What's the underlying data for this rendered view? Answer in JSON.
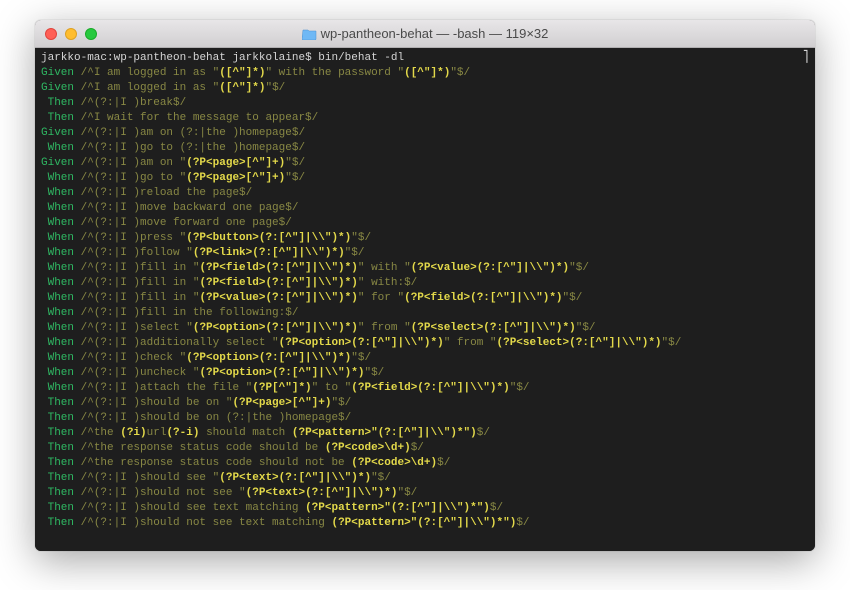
{
  "window": {
    "title": "wp-pantheon-behat — -bash — 119×32"
  },
  "prompt": {
    "host": "jarkko-mac",
    "dir": "wp-pantheon-behat",
    "user": "jarkkolaine",
    "command": "bin/behat -dl"
  },
  "lines": [
    {
      "kw": "Given",
      "pre": " /^I am logged in as \"",
      "hl": "([^\"]*)",
      "mid": "\" with the password \"",
      "hl2": "([^\"]*)",
      "post": "\"$/"
    },
    {
      "kw": "Given",
      "pre": " /^I am logged in as \"",
      "hl": "([^\"]*)",
      "post": "\"$/"
    },
    {
      "kw": " Then",
      "pre": " /^(?:|I )break$/"
    },
    {
      "kw": " Then",
      "pre": " /^I wait for the message to appear$/"
    },
    {
      "kw": "Given",
      "pre": " /^(?:|I )am on (?:|the )homepage$/"
    },
    {
      "kw": " When",
      "pre": " /^(?:|I )go to (?:|the )homepage$/"
    },
    {
      "kw": "Given",
      "pre": " /^(?:|I )am on \"",
      "hl": "(?P<page>[^\"]+)",
      "post": "\"$/"
    },
    {
      "kw": " When",
      "pre": " /^(?:|I )go to \"",
      "hl": "(?P<page>[^\"]+)",
      "post": "\"$/"
    },
    {
      "kw": " When",
      "pre": " /^(?:|I )reload the page$/"
    },
    {
      "kw": " When",
      "pre": " /^(?:|I )move backward one page$/"
    },
    {
      "kw": " When",
      "pre": " /^(?:|I )move forward one page$/"
    },
    {
      "kw": " When",
      "pre": " /^(?:|I )press \"",
      "hl": "(?P<button>(?:[^\"]|\\\\\")*)",
      "post": "\"$/"
    },
    {
      "kw": " When",
      "pre": " /^(?:|I )follow \"",
      "hl": "(?P<link>(?:[^\"]|\\\\\")*)",
      "post": "\"$/"
    },
    {
      "kw": " When",
      "pre": " /^(?:|I )fill in \"",
      "hl": "(?P<field>(?:[^\"]|\\\\\")*)",
      "mid": "\" with \"",
      "hl2": "(?P<value>(?:[^\"]|\\\\\")*)",
      "post": "\"$/"
    },
    {
      "kw": " When",
      "pre": " /^(?:|I )fill in \"",
      "hl": "(?P<field>(?:[^\"]|\\\\\")*)",
      "post": "\" with:$/"
    },
    {
      "kw": " When",
      "pre": " /^(?:|I )fill in \"",
      "hl": "(?P<value>(?:[^\"]|\\\\\")*)",
      "mid": "\" for \"",
      "hl2": "(?P<field>(?:[^\"]|\\\\\")*)",
      "post": "\"$/"
    },
    {
      "kw": " When",
      "pre": " /^(?:|I )fill in the following:$/"
    },
    {
      "kw": " When",
      "pre": " /^(?:|I )select \"",
      "hl": "(?P<option>(?:[^\"]|\\\\\")*)",
      "mid": "\" from \"",
      "hl2": "(?P<select>(?:[^\"]|\\\\\")*)",
      "post": "\"$/"
    },
    {
      "kw": " When",
      "pre": " /^(?:|I )additionally select \"",
      "hl": "(?P<option>(?:[^\"]|\\\\\")*)",
      "mid": "\" from \"",
      "hl2": "(?P<select>(?:[^\"]|\\\\\")*)",
      "post": "\"$/"
    },
    {
      "kw": " When",
      "pre": " /^(?:|I )check \"",
      "hl": "(?P<option>(?:[^\"]|\\\\\")*)",
      "post": "\"$/"
    },
    {
      "kw": " When",
      "pre": " /^(?:|I )uncheck \"",
      "hl": "(?P<option>(?:[^\"]|\\\\\")*)",
      "post": "\"$/"
    },
    {
      "kw": " When",
      "pre": " /^(?:|I )attach the file \"",
      "hl": "(?P[^\"]*)",
      "mid": "\" to \"",
      "hl2": "(?P<field>(?:[^\"]|\\\\\")*)",
      "post": "\"$/"
    },
    {
      "kw": " Then",
      "pre": " /^(?:|I )should be on \"",
      "hl": "(?P<page>[^\"]+)",
      "post": "\"$/"
    },
    {
      "kw": " Then",
      "pre": " /^(?:|I )should be on (?:|the )homepage$/"
    },
    {
      "kw": " Then",
      "pre": " /^the ",
      "hl": "(?i)",
      "mid0": "url",
      "hl0": "(?-i)",
      "mid": " should match ",
      "hl2": "(?P<pattern>\"(?:[^\"]|\\\\\")*\")",
      "post": "$/"
    },
    {
      "kw": " Then",
      "pre": " /^the response status code should be ",
      "hl": "(?P<code>\\d+)",
      "post": "$/"
    },
    {
      "kw": " Then",
      "pre": " /^the response status code should not be ",
      "hl": "(?P<code>\\d+)",
      "post": "$/"
    },
    {
      "kw": " Then",
      "pre": " /^(?:|I )should see \"",
      "hl": "(?P<text>(?:[^\"]|\\\\\")*)",
      "post": "\"$/"
    },
    {
      "kw": " Then",
      "pre": " /^(?:|I )should not see \"",
      "hl": "(?P<text>(?:[^\"]|\\\\\")*)",
      "post": "\"$/"
    },
    {
      "kw": " Then",
      "pre": " /^(?:|I )should see text matching ",
      "hl": "(?P<pattern>\"(?:[^\"]|\\\\\")*\")",
      "post": "$/"
    },
    {
      "kw": " Then",
      "pre": " /^(?:|I )should not see text matching ",
      "hl": "(?P<pattern>\"(?:[^\"]|\\\\\")*\")",
      "post": "$/"
    }
  ]
}
